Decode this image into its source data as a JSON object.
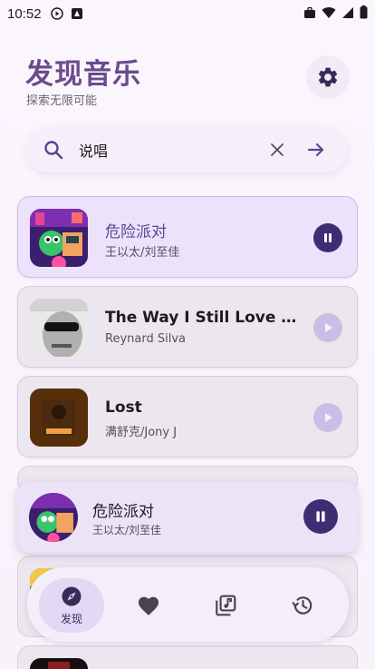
{
  "status_bar": {
    "time": "10:52"
  },
  "header": {
    "title": "发现音乐",
    "subtitle": "探索无限可能"
  },
  "search": {
    "value": "说唱",
    "placeholder": ""
  },
  "songs": [
    {
      "title": "危险派对",
      "artist": "王以太/刘至佳",
      "state": "playing"
    },
    {
      "title": "The Way I Still Love You",
      "artist": "Reynard Silva",
      "state": "idle"
    },
    {
      "title": "Lost",
      "artist": "满舒克/Jony J",
      "state": "idle"
    }
  ],
  "now_playing": {
    "title": "危险派对",
    "artist": "王以太/刘至佳"
  },
  "nav": [
    {
      "label": "发现",
      "icon": "compass-icon",
      "selected": true
    },
    {
      "label": "",
      "icon": "heart-icon",
      "selected": false
    },
    {
      "label": "",
      "icon": "music-library-icon",
      "selected": false
    },
    {
      "label": "",
      "icon": "history-icon",
      "selected": false
    }
  ],
  "colors": {
    "accent": "#6a4b8c",
    "play_active": "#3f2d74",
    "play_idle": "#cbbde6",
    "active_card": "#ece2fb"
  }
}
